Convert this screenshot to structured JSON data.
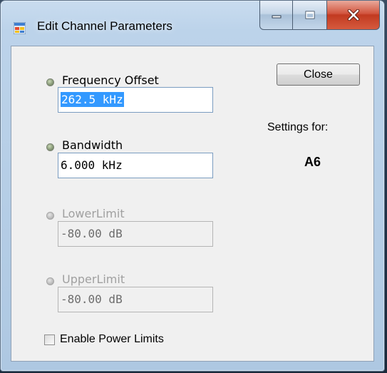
{
  "window": {
    "title": "Edit Channel Parameters",
    "icons": {
      "app": "form-app-icon",
      "minimize": "minimize-icon",
      "maximize": "maximize-icon",
      "close": "close-icon"
    }
  },
  "params": {
    "frequency_offset": {
      "label": "Frequency Offset",
      "value": "262.5 kHz",
      "enabled": true,
      "selected": true
    },
    "bandwidth": {
      "label": "Bandwidth",
      "value": "6.000 kHz",
      "enabled": true
    },
    "lower_limit": {
      "label": "LowerLimit",
      "value": "-80.00 dB",
      "enabled": false
    },
    "upper_limit": {
      "label": "UpperLimit",
      "value": "-80.00 dB",
      "enabled": false
    }
  },
  "actions": {
    "close_label": "Close"
  },
  "settings": {
    "label": "Settings for:",
    "channel": "A6"
  },
  "enable_power_limits": {
    "label": "Enable Power Limits",
    "checked": false
  },
  "colors": {
    "selection": "#3399ff",
    "field_border": "#7a9cc0",
    "close_red": "#c13a20"
  }
}
